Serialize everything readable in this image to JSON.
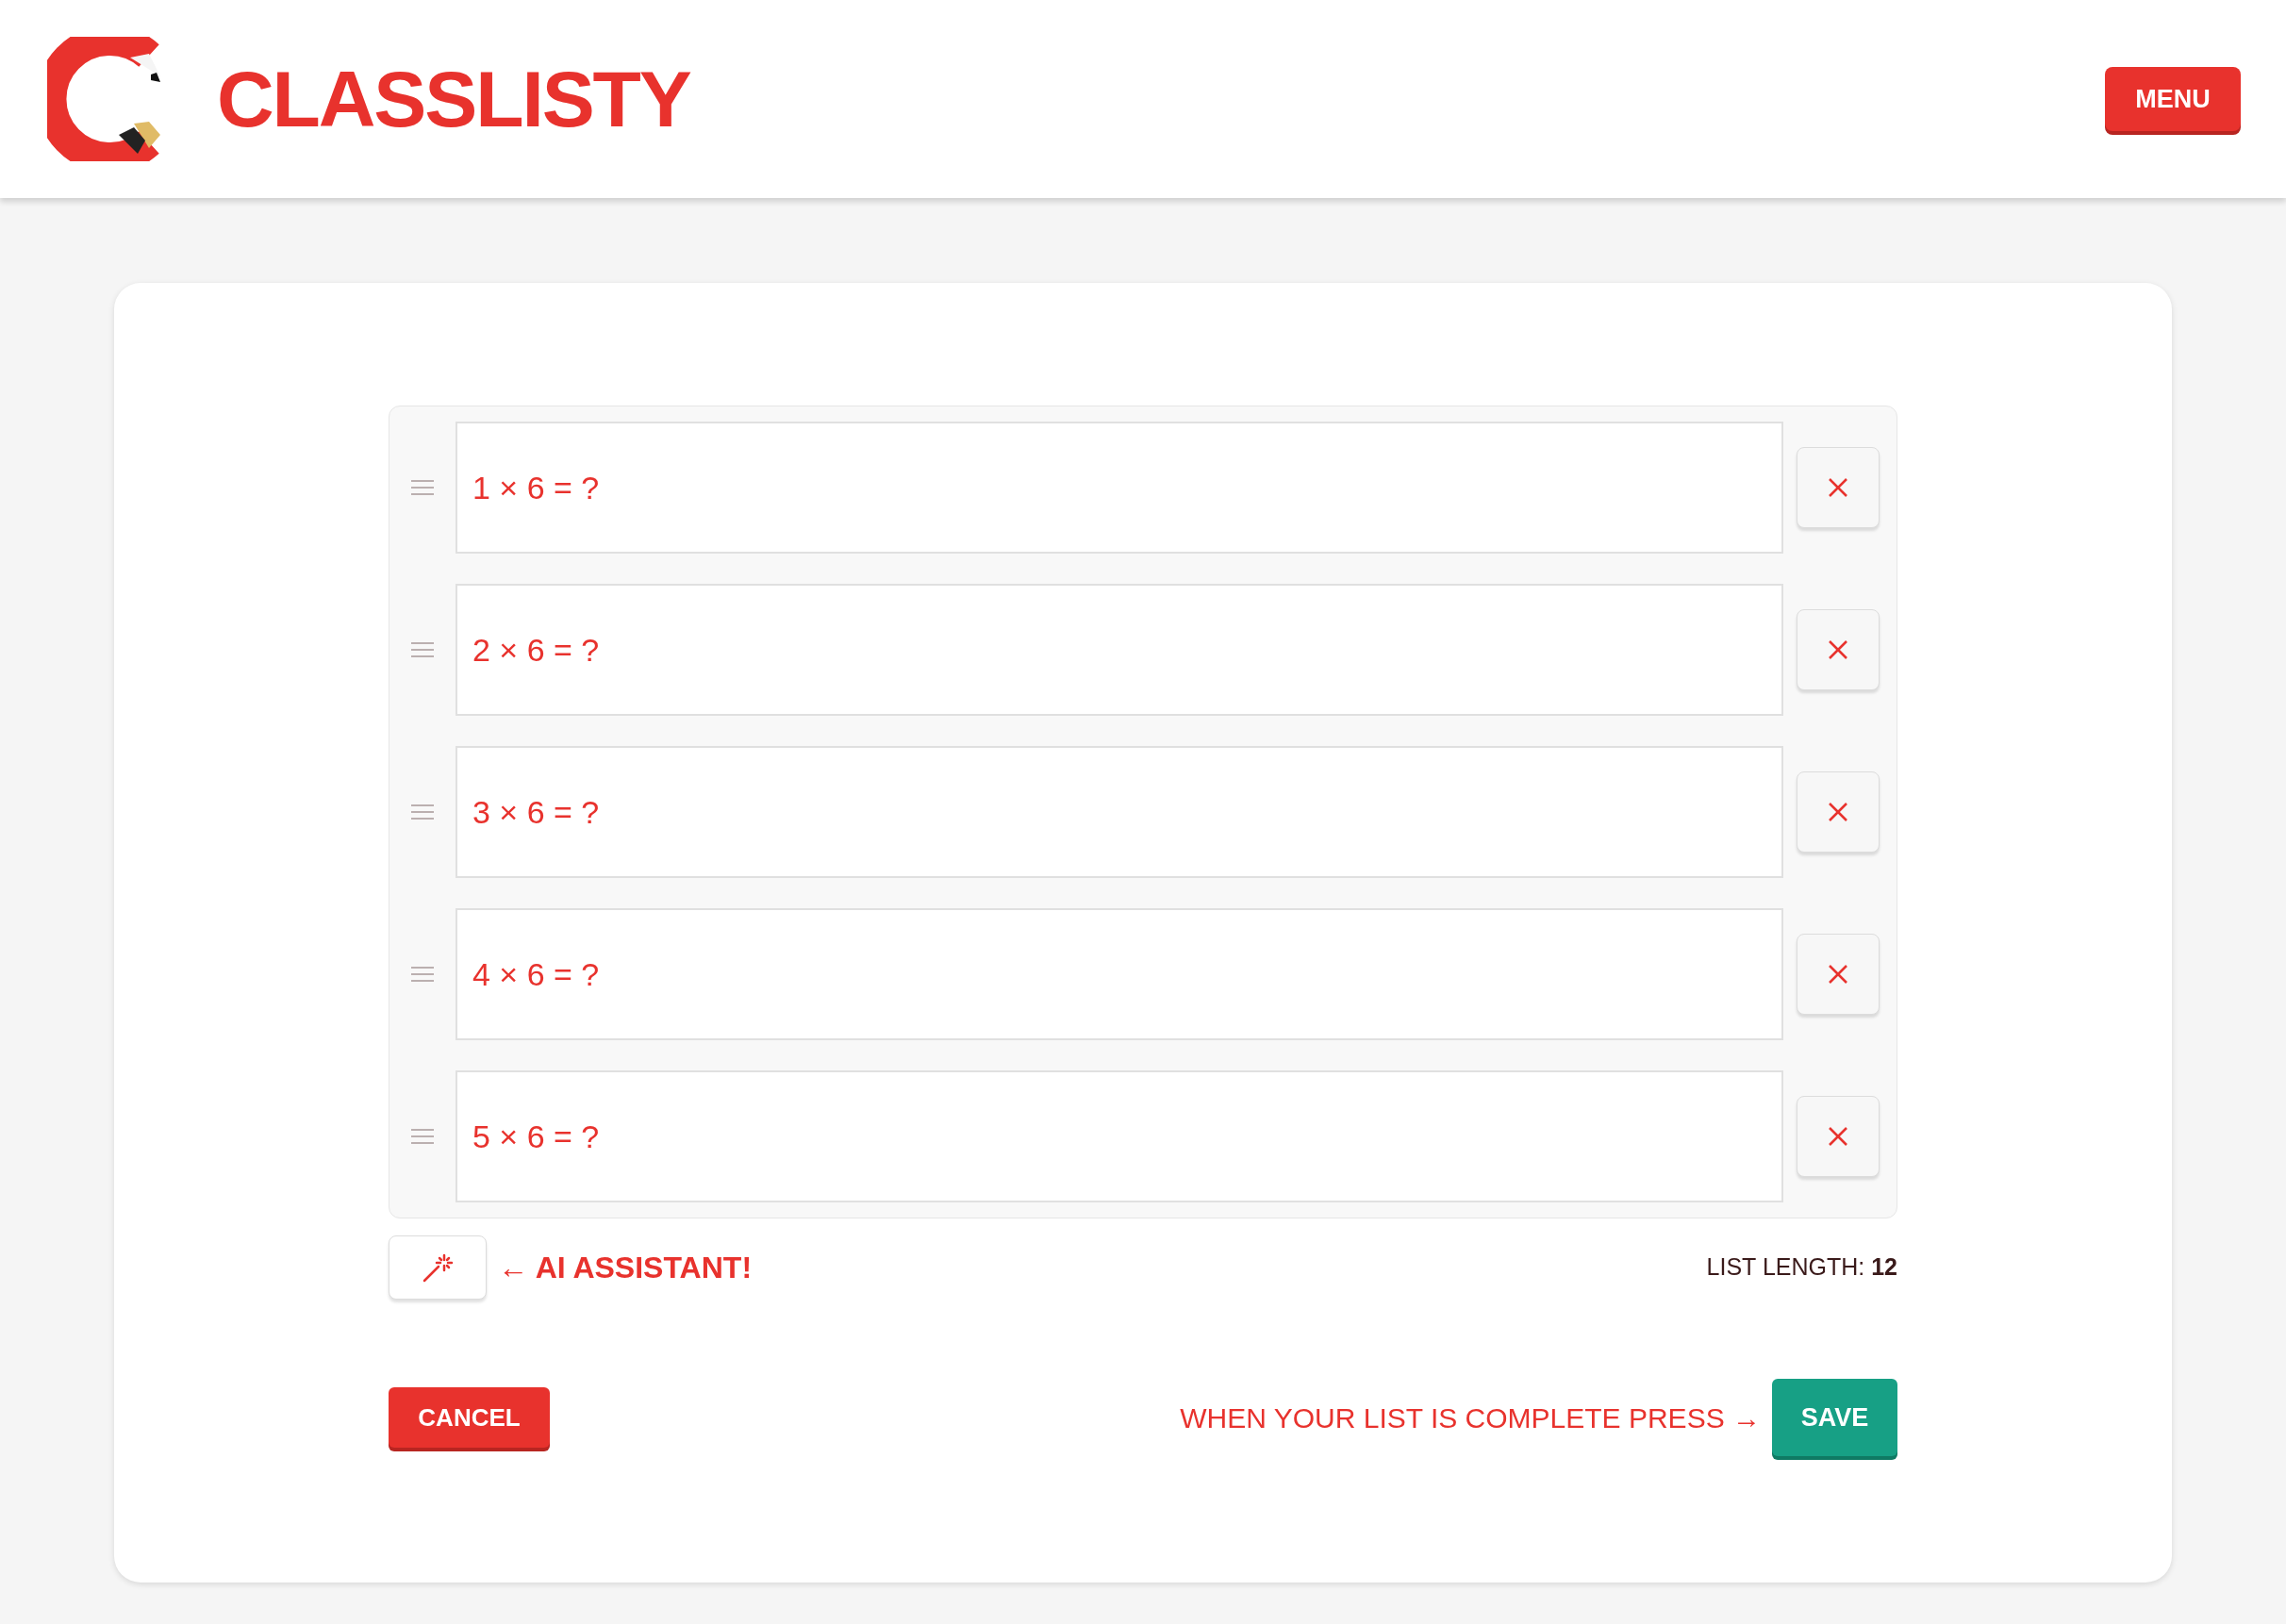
{
  "header": {
    "brand": "CLASSLISTY",
    "menu_button": "MENU"
  },
  "list_items": [
    {
      "text": "1 × 6 = ?"
    },
    {
      "text": "2 × 6 = ?"
    },
    {
      "text": "3 × 6 = ?"
    },
    {
      "text": "4 × 6 = ?"
    },
    {
      "text": "5 × 6 = ?"
    }
  ],
  "ai_hint": "← AI ASSISTANT!",
  "list_length": {
    "label": "LIST LENGTH:",
    "value": "12"
  },
  "cancel_button": "CANCEL",
  "save_hint": "WHEN YOUR LIST IS COMPLETE PRESS →",
  "save_button": "SAVE"
}
